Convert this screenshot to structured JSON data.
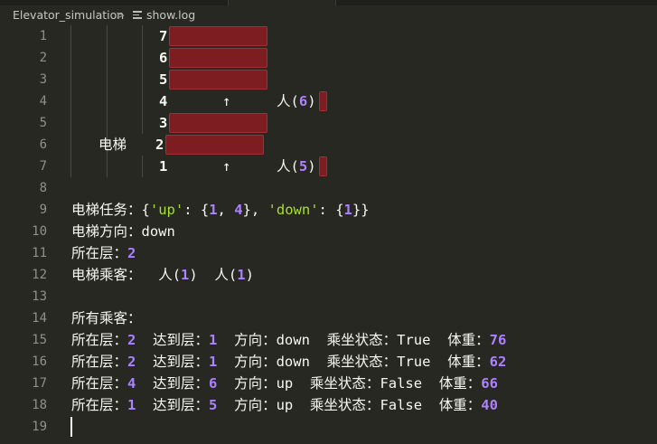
{
  "breadcrumb": {
    "folder": "Elevator_simulation",
    "separator": ">",
    "file": "show.log",
    "file_icon": "lines-file-icon"
  },
  "line_numbers": [
    "1",
    "2",
    "3",
    "4",
    "5",
    "6",
    "7",
    "8",
    "9",
    "10",
    "11",
    "12",
    "13",
    "14",
    "15",
    "16",
    "17",
    "18",
    "19"
  ],
  "viz": {
    "floors": [
      "7",
      "6",
      "5",
      "4",
      "3",
      "2",
      "1"
    ],
    "arrow": "↑",
    "elevator_label": "电梯",
    "waiting": [
      {
        "floor": "4",
        "label": "人(",
        "count": "6",
        "close": ")"
      },
      {
        "floor": "1",
        "label": "人(",
        "count": "5",
        "close": ")"
      }
    ]
  },
  "status": {
    "tasks_label": "电梯任务：",
    "tasks": {
      "open": "{",
      "up_key": "'up'",
      "colon_up": ": {",
      "up_1": "1",
      "comma": ", ",
      "up_2": "4",
      "mid": "}, ",
      "down_key": "'down'",
      "colon_down": ": {",
      "down_1": "1",
      "end": "}}"
    },
    "direction_label": "电梯方向：",
    "direction": "down",
    "floor_label": "所在层：",
    "floor": "2",
    "riders_label": "电梯乘客：",
    "riders": [
      {
        "label": "人(",
        "count": "1",
        "close": ")"
      },
      {
        "label": "人(",
        "count": "1",
        "close": ")"
      }
    ]
  },
  "passengers_title": "所有乘客：",
  "passengers": [
    {
      "at_label": "所在层：",
      "at": "2",
      "dest_label": "达到层：",
      "dest": "1",
      "dir_label": "方向：",
      "dir": "down",
      "ride_label": "乘坐状态：",
      "ride": "True",
      "w_label": "体重：",
      "w": "76"
    },
    {
      "at_label": "所在层：",
      "at": "2",
      "dest_label": "达到层：",
      "dest": "1",
      "dir_label": "方向：",
      "dir": "down",
      "ride_label": "乘坐状态：",
      "ride": "True",
      "w_label": "体重：",
      "w": "62"
    },
    {
      "at_label": "所在层：",
      "at": "4",
      "dest_label": "达到层：",
      "dest": "6",
      "dir_label": "方向：",
      "dir": "up",
      "ride_label": "乘坐状态：",
      "ride": "False",
      "w_label": "体重：",
      "w": "66"
    },
    {
      "at_label": "所在层：",
      "at": "1",
      "dest_label": "达到层：",
      "dest": "5",
      "dir_label": "方向：",
      "dir": "up",
      "ride_label": "乘坐状态：",
      "ride": "False",
      "w_label": "体重：",
      "w": "40"
    }
  ]
}
